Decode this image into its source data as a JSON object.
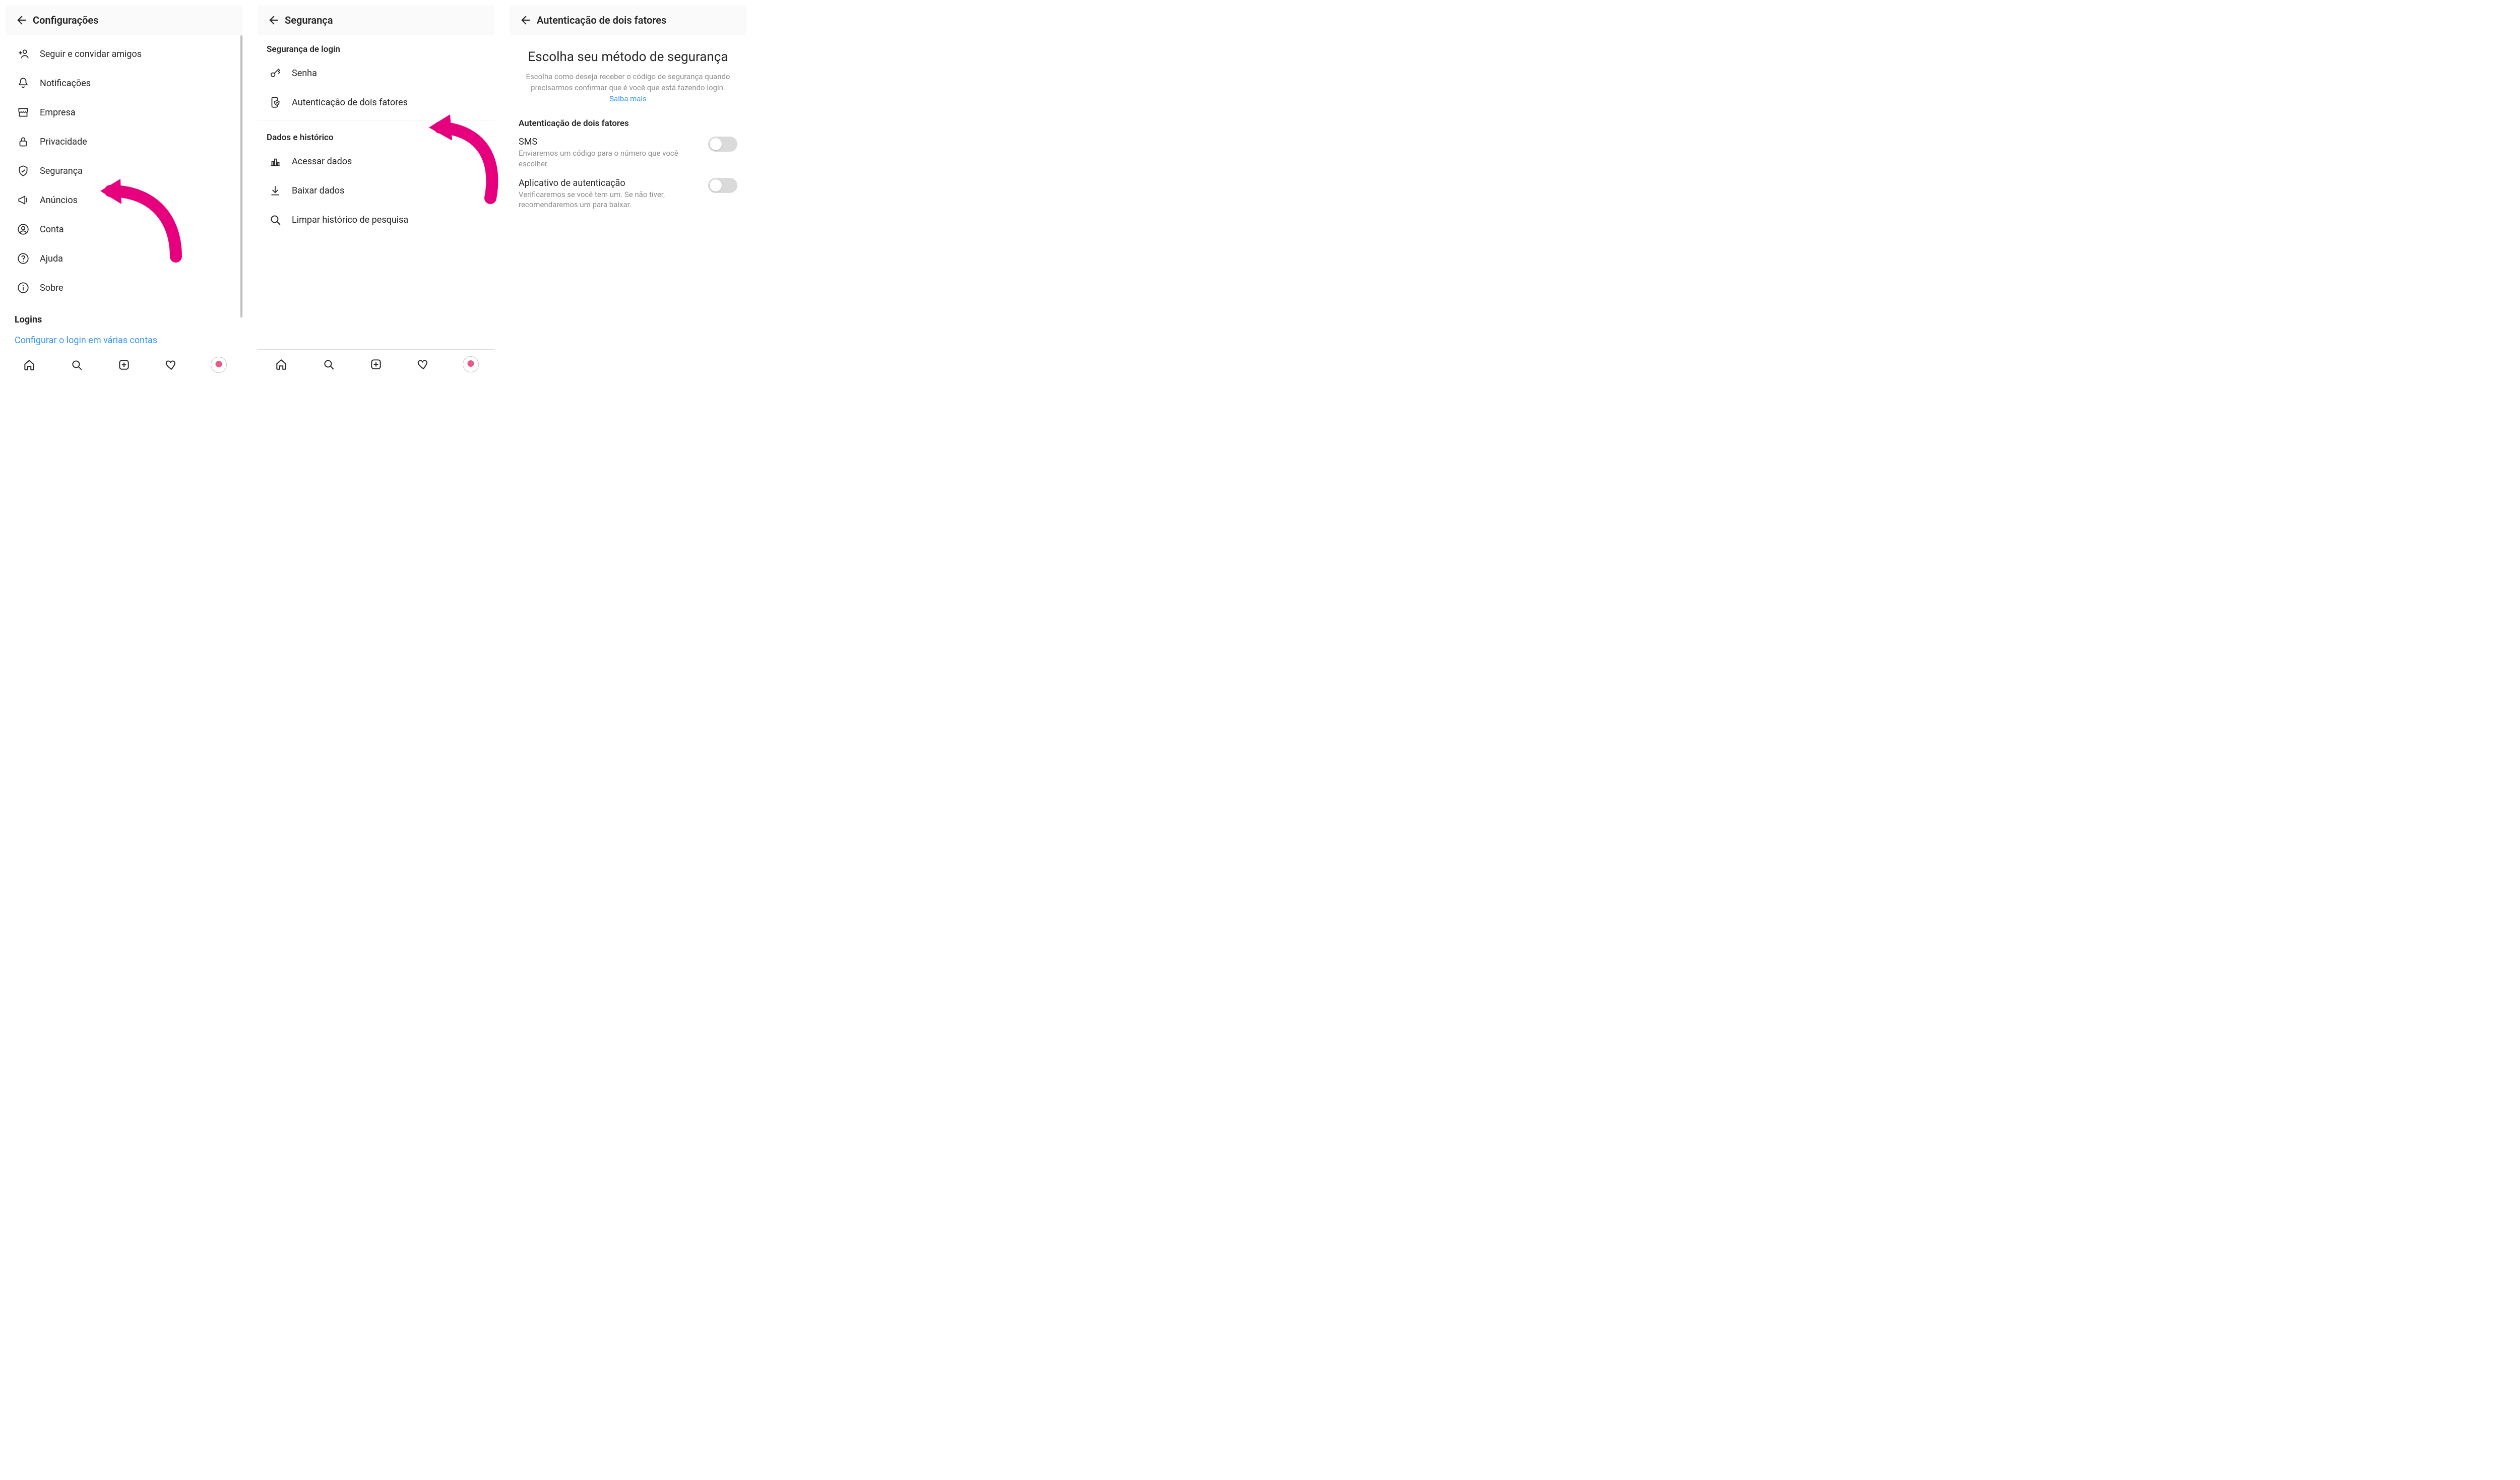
{
  "colors": {
    "accent": "#e6007e",
    "link": "#3897f0",
    "muted": "#8e8e8e"
  },
  "screen1": {
    "title": "Configurações",
    "items": [
      {
        "icon": "add-person",
        "label": "Seguir e convidar amigos"
      },
      {
        "icon": "bell",
        "label": "Notificações"
      },
      {
        "icon": "storefront",
        "label": "Empresa"
      },
      {
        "icon": "lock",
        "label": "Privacidade"
      },
      {
        "icon": "shield-check",
        "label": "Segurança"
      },
      {
        "icon": "megaphone",
        "label": "Anúncios"
      },
      {
        "icon": "user-circle",
        "label": "Conta"
      },
      {
        "icon": "help-circle",
        "label": "Ajuda"
      },
      {
        "icon": "info-circle",
        "label": "Sobre"
      }
    ],
    "logins_heading": "Logins",
    "multi_login_link": "Configurar o login em várias contas"
  },
  "screen2": {
    "title": "Segurança",
    "section1": "Segurança de login",
    "items1": [
      {
        "icon": "key",
        "label": "Senha"
      },
      {
        "icon": "phone-shield",
        "label": "Autenticação de dois fatores"
      }
    ],
    "section2": "Dados e histórico",
    "items2": [
      {
        "icon": "bar-chart",
        "label": "Acessar dados"
      },
      {
        "icon": "download",
        "label": "Baixar dados"
      },
      {
        "icon": "search",
        "label": "Limpar histórico de pesquisa"
      }
    ]
  },
  "screen3": {
    "title": "Autenticação de dois fatores",
    "hero_title": "Escolha seu método de segurança",
    "hero_body": "Escolha como deseja receber o código de segurança quando precisarmos confirmar que é você que está fazendo login. ",
    "hero_link": "Saiba mais",
    "options_heading": "Autenticação de dois fatores",
    "options": [
      {
        "name": "SMS",
        "desc": "Enviaremos um código para o número que você escolher.",
        "on": false
      },
      {
        "name": "Aplicativo de autenticação",
        "desc": "Verificaremos se você tem um. Se não tiver, recomendaremos um para baixar.",
        "on": false
      }
    ]
  }
}
